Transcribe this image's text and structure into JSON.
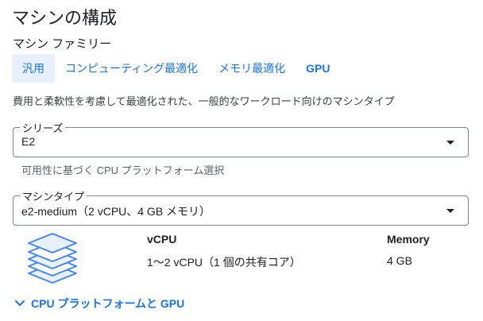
{
  "page": {
    "title": "マシンの構成"
  },
  "family": {
    "label": "マシン ファミリー",
    "tabs": [
      {
        "label": "汎用",
        "active": true
      },
      {
        "label": "コンピューティング最適化",
        "active": false
      },
      {
        "label": "メモリ最適化",
        "active": false
      },
      {
        "label": "GPU",
        "active": false
      }
    ],
    "description": "費用と柔軟性を考慮して最適化された、一般的なワークロード向けのマシンタイプ"
  },
  "series": {
    "label": "シリーズ",
    "value": "E2",
    "hint": "可用性に基づく CPU プラットフォーム選択"
  },
  "machine_type": {
    "label": "マシンタイプ",
    "value": "e2-medium（2 vCPU、4 GB メモリ）"
  },
  "specs": {
    "vcpu_header": "vCPU",
    "vcpu_value": "1～2 vCPU（1 個の共有コア）",
    "memory_header": "Memory",
    "memory_value": "4 GB",
    "icon": "layers-stack-icon"
  },
  "cpu_platform_link": {
    "label": "CPU プラットフォームと GPU",
    "icon": "chevron-down-icon"
  },
  "colors": {
    "accent": "#1a73e8",
    "tab_active_bg": "#e8f0fe",
    "border": "#80868b"
  }
}
